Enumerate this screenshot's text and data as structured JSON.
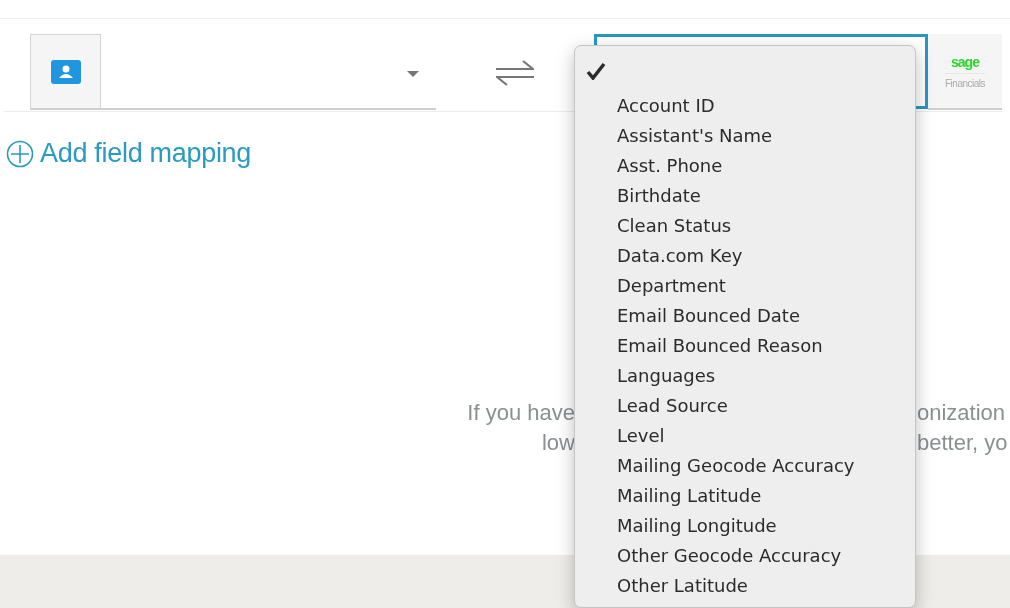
{
  "source_select": {
    "expanded": false
  },
  "target_select": {
    "focused": true,
    "logo_text": "sage",
    "logo_subtext": "Financials"
  },
  "add_mapping": {
    "label": "Add field mapping"
  },
  "info_text": {
    "line_1_left": "If you have",
    "line_1_right": "onization",
    "line_2_left": "low",
    "line_2_right": "better, yo"
  },
  "dropdown_menu": {
    "items": [
      {
        "selected": true
      },
      {
        "label": "Account ID",
        "selected": false
      },
      {
        "label": "Assistant's Name",
        "selected": false
      },
      {
        "label": "Asst. Phone",
        "selected": false
      },
      {
        "label": "Birthdate",
        "selected": false
      },
      {
        "label": "Clean Status",
        "selected": false
      },
      {
        "label": "Data.com Key",
        "selected": false
      },
      {
        "label": "Department",
        "selected": false
      },
      {
        "label": "Email Bounced Date",
        "selected": false
      },
      {
        "label": "Email Bounced Reason",
        "selected": false
      },
      {
        "label": "Languages",
        "selected": false
      },
      {
        "label": "Lead Source",
        "selected": false
      },
      {
        "label": "Level",
        "selected": false
      },
      {
        "label": "Mailing Geocode Accuracy",
        "selected": false
      },
      {
        "label": "Mailing Latitude",
        "selected": false
      },
      {
        "label": "Mailing Longitude",
        "selected": false
      },
      {
        "label": "Other Geocode Accuracy",
        "selected": false
      },
      {
        "label": "Other Latitude",
        "selected": false
      }
    ]
  }
}
